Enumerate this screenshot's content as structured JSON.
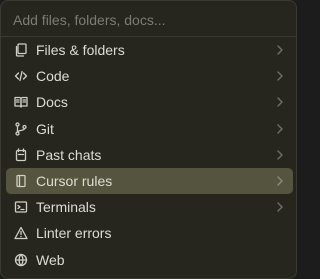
{
  "search": {
    "placeholder": "Add files, folders, docs..."
  },
  "menu": {
    "items": [
      {
        "label": "Files & folders",
        "icon": "files-icon",
        "has_submenu": true,
        "selected": false
      },
      {
        "label": "Code",
        "icon": "code-icon",
        "has_submenu": true,
        "selected": false
      },
      {
        "label": "Docs",
        "icon": "book-icon",
        "has_submenu": true,
        "selected": false
      },
      {
        "label": "Git",
        "icon": "git-branch-icon",
        "has_submenu": true,
        "selected": false
      },
      {
        "label": "Past chats",
        "icon": "chat-history-icon",
        "has_submenu": true,
        "selected": false
      },
      {
        "label": "Cursor rules",
        "icon": "rules-file-icon",
        "has_submenu": true,
        "selected": true
      },
      {
        "label": "Terminals",
        "icon": "terminal-icon",
        "has_submenu": true,
        "selected": false
      },
      {
        "label": "Linter errors",
        "icon": "warning-icon",
        "has_submenu": false,
        "selected": false
      },
      {
        "label": "Web",
        "icon": "globe-icon",
        "has_submenu": false,
        "selected": false
      }
    ]
  },
  "colors": {
    "background": "#26261f",
    "selected_background": "#55553f",
    "text": "#dcdcd2",
    "placeholder": "#7c7c72"
  }
}
